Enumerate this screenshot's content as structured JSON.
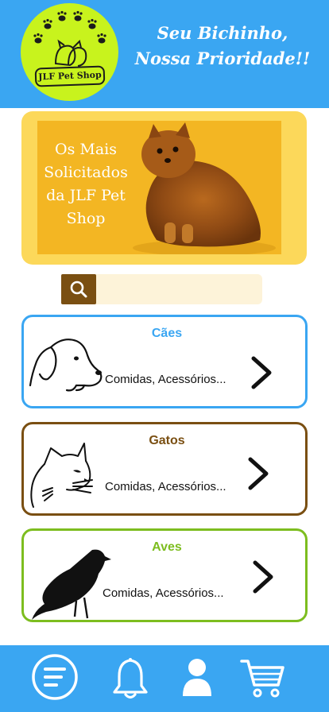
{
  "header": {
    "logo_text": "JLF Pet Shop",
    "slogan_line1": "Seu Bichinho,",
    "slogan_line2": "Nossa Prioridade!!"
  },
  "banner": {
    "text": "Os Mais Solicitados da JLF Pet Shop"
  },
  "search": {
    "value": "",
    "placeholder": ""
  },
  "categories": [
    {
      "title": "Cães",
      "subtitle": "Comidas, Acessórios...",
      "color": "#3aa6f2",
      "icon": "dog-icon"
    },
    {
      "title": "Gatos",
      "subtitle": "Comidas, Acessórios...",
      "color": "#7a4f12",
      "icon": "cat-icon"
    },
    {
      "title": "Aves",
      "subtitle": "Comidas, Acessórios...",
      "color": "#7dbd1f",
      "icon": "bird-icon"
    }
  ],
  "nav": [
    "menu-icon",
    "bell-icon",
    "profile-icon",
    "cart-icon"
  ],
  "colors": {
    "primary": "#3aa6f2",
    "logo_green": "#c8f31d",
    "banner_yellow": "#fcd85a",
    "brown": "#7a4f12",
    "green": "#7dbd1f"
  }
}
